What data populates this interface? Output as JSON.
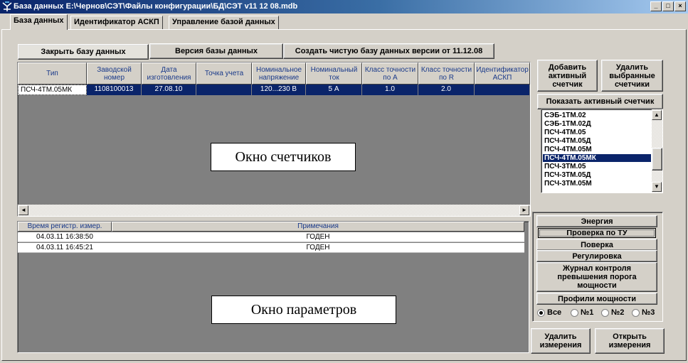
{
  "window": {
    "title": "База данных E:\\Чернов\\СЭТ\\Файлы конфигурации\\БД\\СЭТ v11 12 08.mdb",
    "minimize": "_",
    "maximize": "□",
    "close": "×"
  },
  "tabs": [
    {
      "label": "База данных",
      "active": true
    },
    {
      "label": "Идентификатор АСКП",
      "active": false
    },
    {
      "label": "Управление базой данных",
      "active": false
    }
  ],
  "toolbar": {
    "close_db": "Закрыть базу данных",
    "db_version": "Версия базы данных",
    "create_clean": "Создать чистую базу данных версии от 11.12.08"
  },
  "meters_table": {
    "columns": [
      "Тип",
      "Заводской номер",
      "Дата изготовления",
      "Точка учета",
      "Номинальное напряжение",
      "Номинальный ток",
      "Класс точности по А",
      "Класс точности по R",
      "Идентификатор АСКП"
    ],
    "rows": [
      [
        "ПСЧ-4ТМ.05МК",
        "1108100013",
        "27.08.10",
        "",
        "120...230 В",
        "5 А",
        "1.0",
        "2.0",
        ""
      ]
    ],
    "overlay_label": "Окно счетчиков"
  },
  "right_panel": {
    "add_active": "Добавить активный счетчик",
    "delete_selected": "Удалить выбранные счетчики",
    "show_active": "Показать активный счетчик",
    "meter_types": [
      "СЭБ-1ТМ.02",
      "СЭБ-1ТМ.02Д",
      "ПСЧ-4ТМ.05",
      "ПСЧ-4ТМ.05Д",
      "ПСЧ-4ТМ.05М",
      "ПСЧ-4ТМ.05МК",
      "ПСЧ-3ТМ.05",
      "ПСЧ-3ТМ.05Д",
      "ПСЧ-3ТМ.05М"
    ],
    "selected_index": 5
  },
  "params_table": {
    "columns": [
      "Время регистр. измер.",
      "Примечания"
    ],
    "rows": [
      [
        "04.03.11 16:38:50",
        "ГОДЕН"
      ],
      [
        "04.03.11 16:45:21",
        "ГОДЕН"
      ]
    ],
    "overlay_label": "Окно параметров"
  },
  "measure_panel": {
    "energy": "Энергия",
    "verify_tu": "Проверка по ТУ",
    "verify": "Поверка",
    "regulate": "Регулировка",
    "journal": "Журнал контроля превышения порога мощности",
    "profiles": "Профили мощности",
    "radios": [
      {
        "label": "Все",
        "checked": true
      },
      {
        "label": "№1",
        "checked": false
      },
      {
        "label": "№2",
        "checked": false
      },
      {
        "label": "№3",
        "checked": false
      }
    ],
    "delete_meas": "Удалить измерения",
    "open_meas": "Открыть измерения"
  },
  "icons": {
    "app": "meter-app-icon",
    "scroll_up": "▲",
    "scroll_down": "▼",
    "scroll_left": "◄",
    "scroll_right": "►"
  }
}
